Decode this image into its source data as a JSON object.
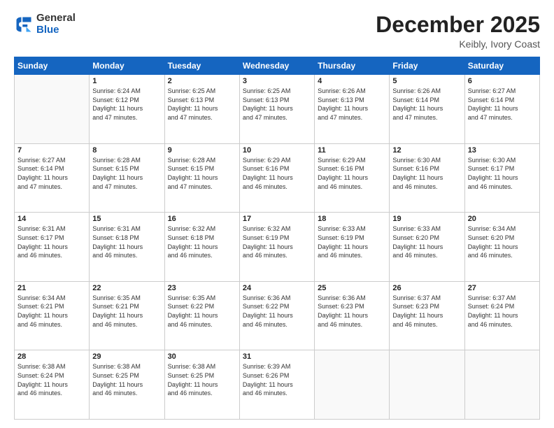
{
  "header": {
    "logo_general": "General",
    "logo_blue": "Blue",
    "month_title": "December 2025",
    "location": "Keibly, Ivory Coast"
  },
  "weekdays": [
    "Sunday",
    "Monday",
    "Tuesday",
    "Wednesday",
    "Thursday",
    "Friday",
    "Saturday"
  ],
  "weeks": [
    [
      {
        "day": "",
        "info": ""
      },
      {
        "day": "1",
        "info": "Sunrise: 6:24 AM\nSunset: 6:12 PM\nDaylight: 11 hours\nand 47 minutes."
      },
      {
        "day": "2",
        "info": "Sunrise: 6:25 AM\nSunset: 6:13 PM\nDaylight: 11 hours\nand 47 minutes."
      },
      {
        "day": "3",
        "info": "Sunrise: 6:25 AM\nSunset: 6:13 PM\nDaylight: 11 hours\nand 47 minutes."
      },
      {
        "day": "4",
        "info": "Sunrise: 6:26 AM\nSunset: 6:13 PM\nDaylight: 11 hours\nand 47 minutes."
      },
      {
        "day": "5",
        "info": "Sunrise: 6:26 AM\nSunset: 6:14 PM\nDaylight: 11 hours\nand 47 minutes."
      },
      {
        "day": "6",
        "info": "Sunrise: 6:27 AM\nSunset: 6:14 PM\nDaylight: 11 hours\nand 47 minutes."
      }
    ],
    [
      {
        "day": "7",
        "info": "Sunrise: 6:27 AM\nSunset: 6:14 PM\nDaylight: 11 hours\nand 47 minutes."
      },
      {
        "day": "8",
        "info": "Sunrise: 6:28 AM\nSunset: 6:15 PM\nDaylight: 11 hours\nand 47 minutes."
      },
      {
        "day": "9",
        "info": "Sunrise: 6:28 AM\nSunset: 6:15 PM\nDaylight: 11 hours\nand 47 minutes."
      },
      {
        "day": "10",
        "info": "Sunrise: 6:29 AM\nSunset: 6:16 PM\nDaylight: 11 hours\nand 46 minutes."
      },
      {
        "day": "11",
        "info": "Sunrise: 6:29 AM\nSunset: 6:16 PM\nDaylight: 11 hours\nand 46 minutes."
      },
      {
        "day": "12",
        "info": "Sunrise: 6:30 AM\nSunset: 6:16 PM\nDaylight: 11 hours\nand 46 minutes."
      },
      {
        "day": "13",
        "info": "Sunrise: 6:30 AM\nSunset: 6:17 PM\nDaylight: 11 hours\nand 46 minutes."
      }
    ],
    [
      {
        "day": "14",
        "info": "Sunrise: 6:31 AM\nSunset: 6:17 PM\nDaylight: 11 hours\nand 46 minutes."
      },
      {
        "day": "15",
        "info": "Sunrise: 6:31 AM\nSunset: 6:18 PM\nDaylight: 11 hours\nand 46 minutes."
      },
      {
        "day": "16",
        "info": "Sunrise: 6:32 AM\nSunset: 6:18 PM\nDaylight: 11 hours\nand 46 minutes."
      },
      {
        "day": "17",
        "info": "Sunrise: 6:32 AM\nSunset: 6:19 PM\nDaylight: 11 hours\nand 46 minutes."
      },
      {
        "day": "18",
        "info": "Sunrise: 6:33 AM\nSunset: 6:19 PM\nDaylight: 11 hours\nand 46 minutes."
      },
      {
        "day": "19",
        "info": "Sunrise: 6:33 AM\nSunset: 6:20 PM\nDaylight: 11 hours\nand 46 minutes."
      },
      {
        "day": "20",
        "info": "Sunrise: 6:34 AM\nSunset: 6:20 PM\nDaylight: 11 hours\nand 46 minutes."
      }
    ],
    [
      {
        "day": "21",
        "info": "Sunrise: 6:34 AM\nSunset: 6:21 PM\nDaylight: 11 hours\nand 46 minutes."
      },
      {
        "day": "22",
        "info": "Sunrise: 6:35 AM\nSunset: 6:21 PM\nDaylight: 11 hours\nand 46 minutes."
      },
      {
        "day": "23",
        "info": "Sunrise: 6:35 AM\nSunset: 6:22 PM\nDaylight: 11 hours\nand 46 minutes."
      },
      {
        "day": "24",
        "info": "Sunrise: 6:36 AM\nSunset: 6:22 PM\nDaylight: 11 hours\nand 46 minutes."
      },
      {
        "day": "25",
        "info": "Sunrise: 6:36 AM\nSunset: 6:23 PM\nDaylight: 11 hours\nand 46 minutes."
      },
      {
        "day": "26",
        "info": "Sunrise: 6:37 AM\nSunset: 6:23 PM\nDaylight: 11 hours\nand 46 minutes."
      },
      {
        "day": "27",
        "info": "Sunrise: 6:37 AM\nSunset: 6:24 PM\nDaylight: 11 hours\nand 46 minutes."
      }
    ],
    [
      {
        "day": "28",
        "info": "Sunrise: 6:38 AM\nSunset: 6:24 PM\nDaylight: 11 hours\nand 46 minutes."
      },
      {
        "day": "29",
        "info": "Sunrise: 6:38 AM\nSunset: 6:25 PM\nDaylight: 11 hours\nand 46 minutes."
      },
      {
        "day": "30",
        "info": "Sunrise: 6:38 AM\nSunset: 6:25 PM\nDaylight: 11 hours\nand 46 minutes."
      },
      {
        "day": "31",
        "info": "Sunrise: 6:39 AM\nSunset: 6:26 PM\nDaylight: 11 hours\nand 46 minutes."
      },
      {
        "day": "",
        "info": ""
      },
      {
        "day": "",
        "info": ""
      },
      {
        "day": "",
        "info": ""
      }
    ]
  ]
}
